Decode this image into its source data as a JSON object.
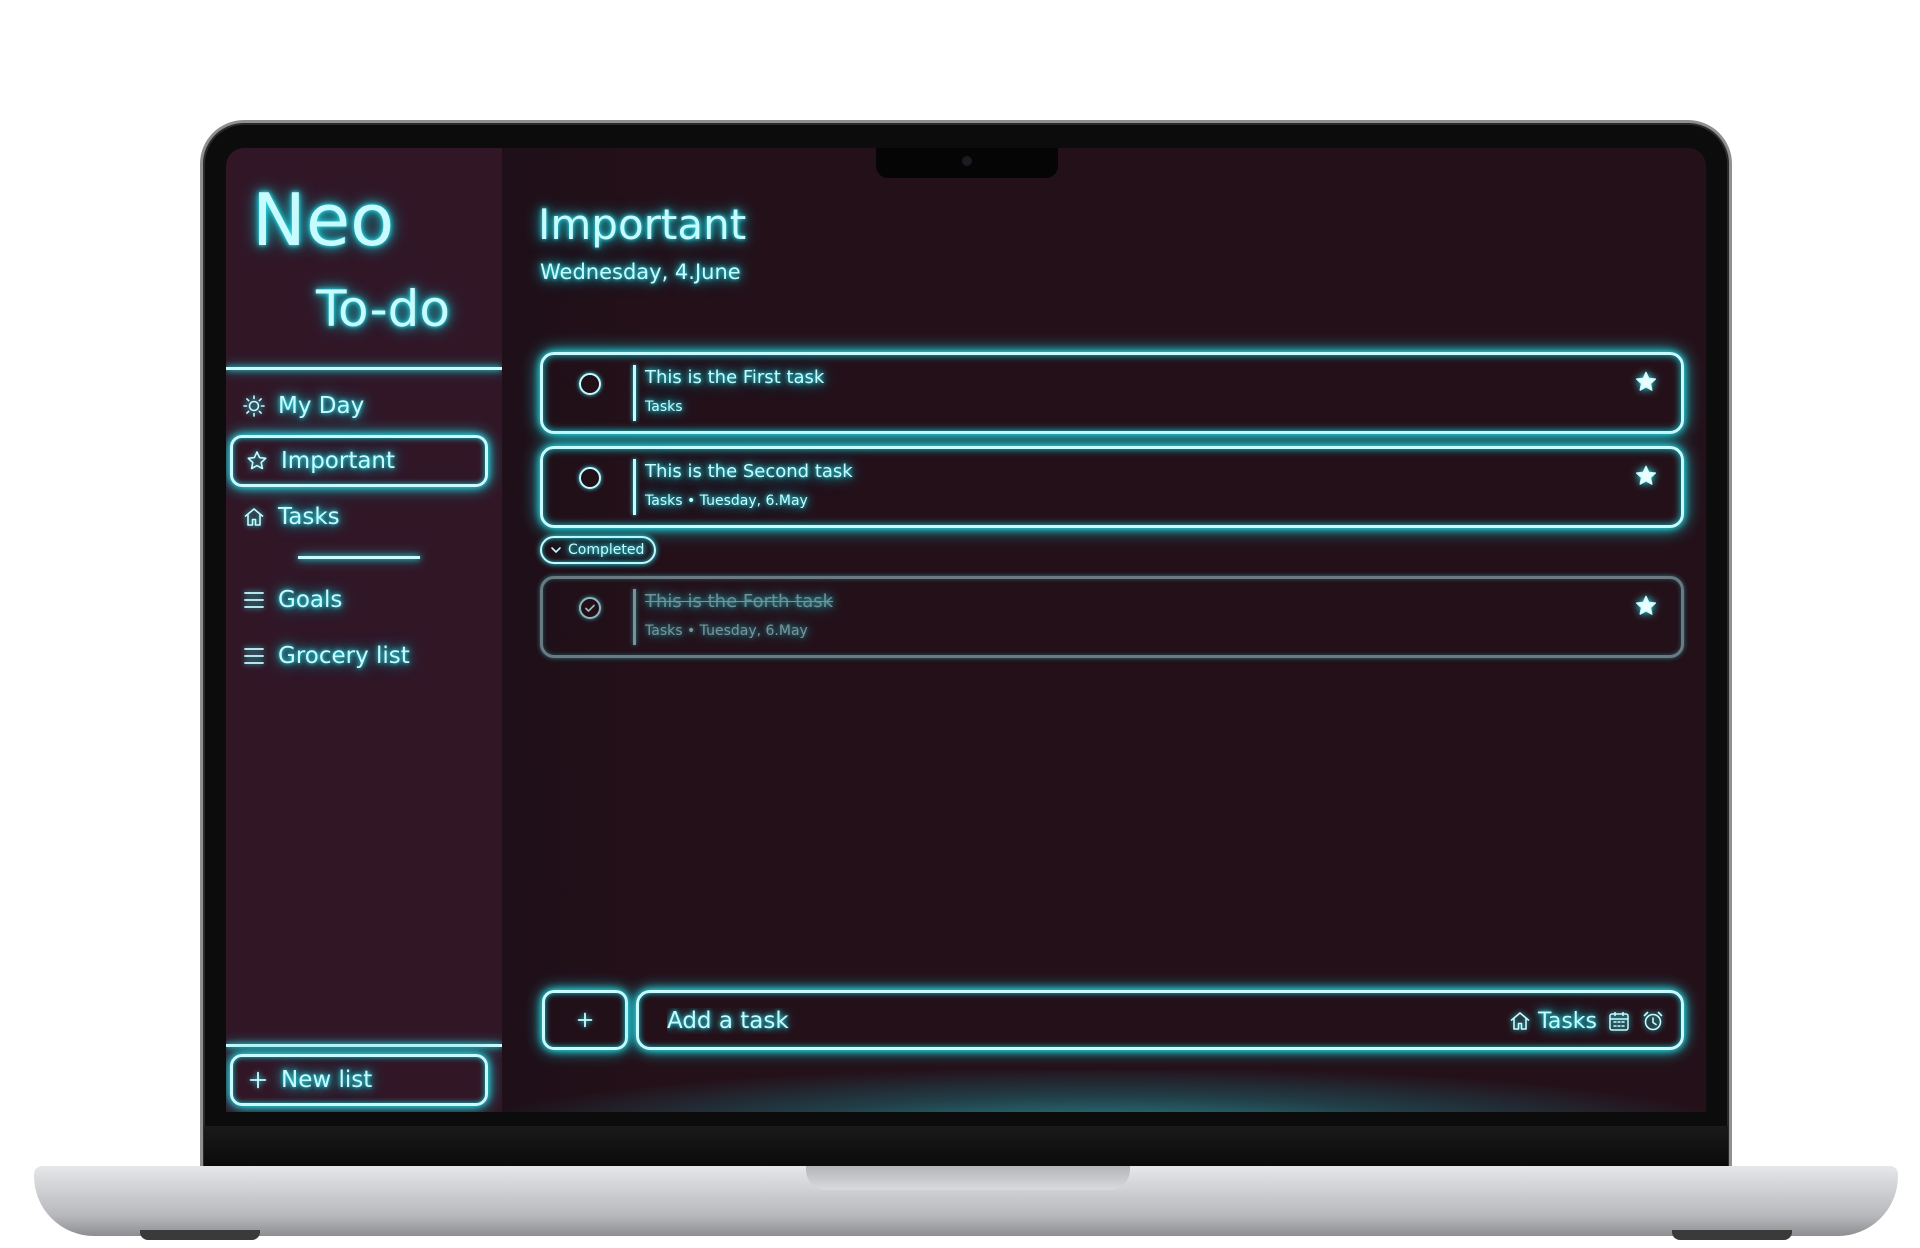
{
  "brand": {
    "line1": "Neo",
    "line2": "To-do"
  },
  "sidebar": {
    "items": [
      {
        "label": "My Day",
        "icon": "sun-icon"
      },
      {
        "label": "Important",
        "icon": "star-outline-icon",
        "active": true
      },
      {
        "label": "Tasks",
        "icon": "home-icon"
      }
    ],
    "lists": [
      {
        "label": "Goals",
        "icon": "list-icon"
      },
      {
        "label": "Grocery list",
        "icon": "list-icon"
      }
    ],
    "new_list_label": "New list"
  },
  "main": {
    "title": "Important",
    "date": "Wednesday, 4.June",
    "tasks": [
      {
        "title": "This is the First task",
        "meta": "Tasks",
        "important": true,
        "completed": false
      },
      {
        "title": "This is the Second task",
        "meta": "Tasks • Tuesday, 6.May",
        "important": true,
        "completed": false
      }
    ],
    "completed_label": "Completed",
    "completed_tasks": [
      {
        "title": "This is the Forth task",
        "meta": "Tasks • Tuesday, 6.May",
        "important": true,
        "completed": true
      }
    ],
    "add_task": {
      "placeholder": "Add a task",
      "list_label": "Tasks"
    }
  },
  "colors": {
    "neon": "#c7fbff",
    "glow": "#2ee8f0",
    "sidebar_bg": "#311626",
    "main_bg": "#241019"
  }
}
